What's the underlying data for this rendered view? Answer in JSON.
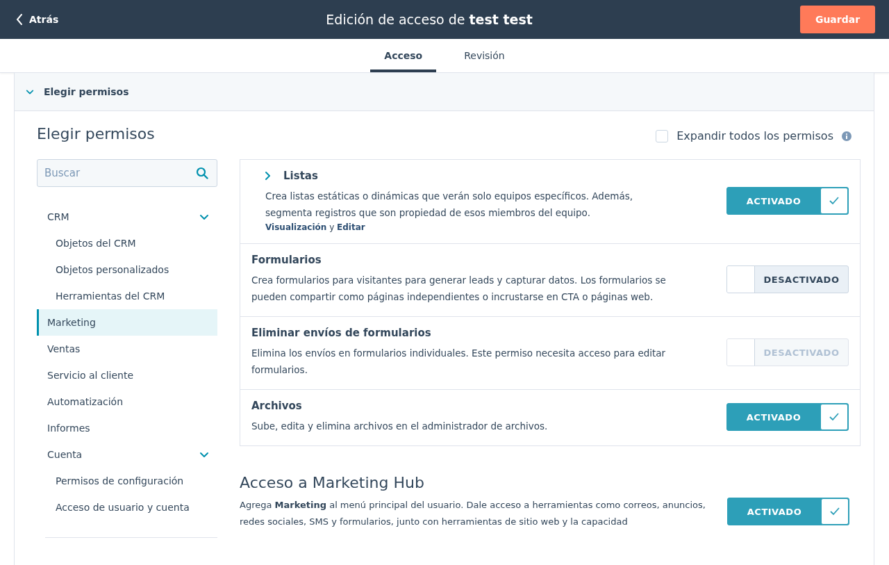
{
  "header": {
    "back": "Atrás",
    "title": "Edición de acceso de **test test**",
    "save": "Guardar"
  },
  "tabs": [
    {
      "label": "Acceso",
      "selected": true
    },
    {
      "label": "Revisión",
      "selected": false
    }
  ],
  "section": {
    "title": "Elegir permisos",
    "expanded": true
  },
  "heading": "Elegir permisos",
  "expand_all": {
    "label": "Expandir todos los permisos",
    "checked": false
  },
  "search": {
    "placeholder": "Buscar"
  },
  "nav": [
    {
      "label": "CRM",
      "selected": false,
      "expanded": true,
      "children": [
        {
          "label": "Objetos del CRM",
          "selected": false
        },
        {
          "label": "Objetos personalizados",
          "selected": false
        },
        {
          "label": "Herramientas del CRM",
          "selected": false
        }
      ]
    },
    {
      "label": "Marketing",
      "selected": true
    },
    {
      "label": "Ventas",
      "selected": false
    },
    {
      "label": "Servicio al cliente",
      "selected": false
    },
    {
      "label": "Automatización",
      "selected": false
    },
    {
      "label": "Informes",
      "selected": false
    },
    {
      "label": "Cuenta",
      "selected": false,
      "expanded": true,
      "children": [
        {
          "label": "Permisos de configuración",
          "selected": false
        },
        {
          "label": "Acceso de usuario y cuenta",
          "selected": false
        }
      ]
    }
  ],
  "permissions": [
    {
      "title": "Listas",
      "expanded": false,
      "description": "Crea listas estáticas o dinámicas que verán solo equipos específicos. Además, segmenta registros que son propiedad de esos miembros del equipo.",
      "links": [
        "Visualización",
        "Editar"
      ],
      "links_joiner": "y",
      "toggle": {
        "on": true,
        "disabled": false,
        "label": "ACTIVADO"
      }
    },
    {
      "title": "Formularios",
      "description": "Crea formularios para visitantes para generar leads y capturar datos. Los formularios se pueden compartir como páginas independientes o incrustarse en CTA o páginas web.",
      "toggle": {
        "on": false,
        "disabled": false,
        "label": "DESACTIVADO"
      }
    },
    {
      "title": "Eliminar envíos de formularios",
      "description": "Elimina los envíos en formularios individuales. Este permiso necesita acceso para editar formularios.",
      "toggle": {
        "on": false,
        "disabled": true,
        "label": "DESACTIVADO"
      }
    },
    {
      "title": "Archivos",
      "description": "Sube, edita y elimina archivos en el administrador de archivos.",
      "toggle": {
        "on": true,
        "disabled": false,
        "label": "ACTIVADO"
      }
    }
  ],
  "hub": {
    "title": "Acceso a Marketing Hub",
    "description": "Agrega **Marketing** al menú principal del usuario. Dale acceso a herramientas como correos, anuncios, redes sociales, SMS y formularios, junto con herramientas de sitio web y la capacidad",
    "toggle": {
      "on": true,
      "disabled": false,
      "label": "ACTIVADO"
    }
  }
}
